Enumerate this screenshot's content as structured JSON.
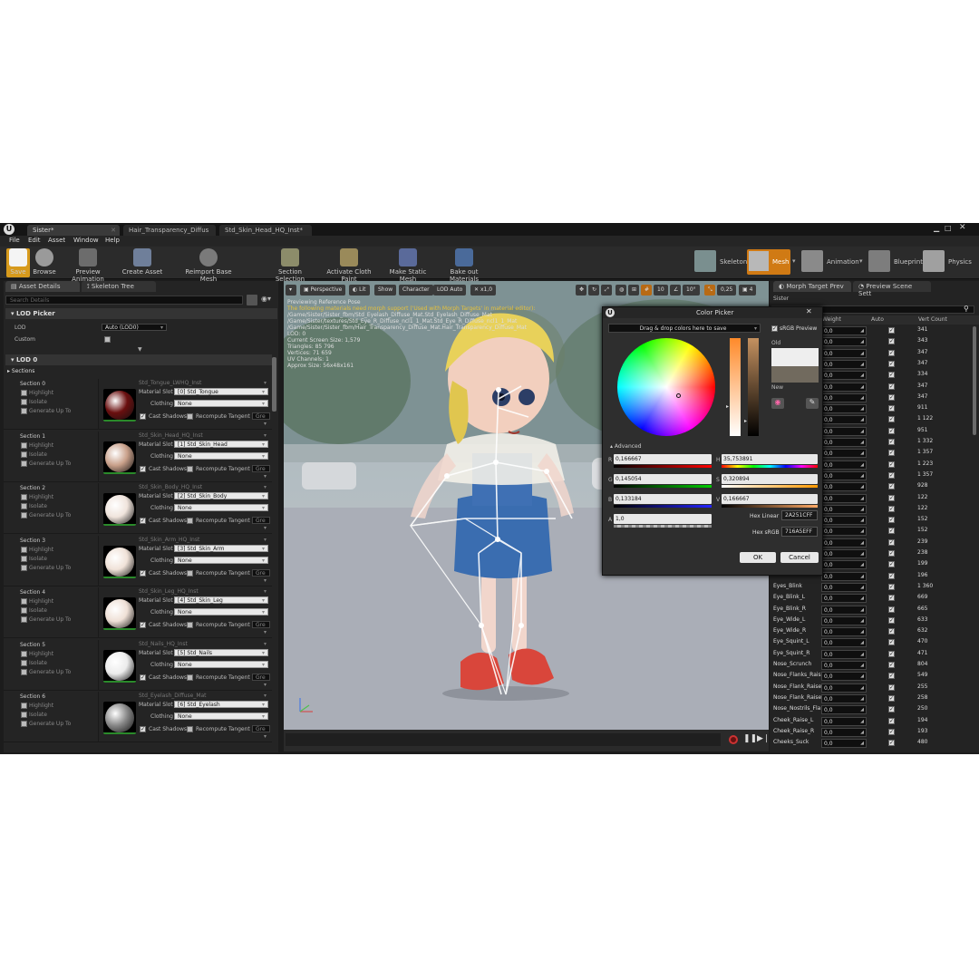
{
  "tabs": [
    {
      "label": "Sister*"
    },
    {
      "label": "Hair_Transparency_Diffus"
    },
    {
      "label": "Std_Skin_Head_HQ_Inst*"
    }
  ],
  "menu": [
    "File",
    "Edit",
    "Asset",
    "Window",
    "Help"
  ],
  "toolbar": {
    "save": "Save",
    "browse": "Browse",
    "preview_animation": "Preview Animation",
    "create_asset": "Create Asset",
    "reimport_base_mesh": "Reimport Base Mesh",
    "section_selection": "Section Selection",
    "activate_cloth_paint": "Activate Cloth Paint",
    "make_static_mesh": "Make Static Mesh",
    "bake_out_materials": "Bake out Materials",
    "modes": {
      "skeleton": "Skeleton",
      "mesh": "Mesh",
      "animation": "Animation",
      "blueprint": "Blueprint",
      "physics": "Physics"
    }
  },
  "left_panel": {
    "tab_asset_details": "Asset Details",
    "tab_skeleton_tree": "Skeleton Tree",
    "search_placeholder": "Search Details",
    "lod_picker": "LOD Picker",
    "lod_label": "LOD",
    "lod_value": "Auto (LOD0)",
    "custom_label": "Custom",
    "lod0": "LOD 0",
    "sections": "Sections",
    "highlight": "Highlight",
    "isolate": "Isolate",
    "generate_up_to": "Generate Up To",
    "material_slot": "Material Slot",
    "clothing": "Clothing",
    "clothing_value": "None",
    "cast_shadows": "Cast Shadows",
    "recompute_tangent": "Recompute Tangent",
    "gre": "Gre",
    "section_items": [
      {
        "title": "Section 0",
        "material": "Std_Tongue_LWHQ_Inst",
        "slot": "[0] Std_Tongue",
        "ball": "#6a0f0f"
      },
      {
        "title": "Section 1",
        "material": "Std_Skin_Head_HQ_Inst",
        "slot": "[1] Std_Skin_Head",
        "ball": "#c9a08a"
      },
      {
        "title": "Section 2",
        "material": "Std_Skin_Body_HQ_Inst",
        "slot": "[2] Std_Skin_Body",
        "ball": "#f0e4dc"
      },
      {
        "title": "Section 3",
        "material": "Std_Skin_Arm_HQ_Inst",
        "slot": "[3] Std_Skin_Arm",
        "ball": "#f0e2d8"
      },
      {
        "title": "Section 4",
        "material": "Std_Skin_Leg_HQ_Inst",
        "slot": "[4] Std_Skin_Leg",
        "ball": "#efe0d6"
      },
      {
        "title": "Section 5",
        "material": "Std_Nails_HQ_Inst",
        "slot": "[5] Std_Nails",
        "ball": "#ececec"
      },
      {
        "title": "Section 6",
        "material": "Std_Eyelash_Diffuse_Mat",
        "slot": "[6] Std_Eyelash",
        "ball": "#888888"
      }
    ]
  },
  "viewport": {
    "perspective": "Perspective",
    "lit": "Lit",
    "show": "Show",
    "character": "Character",
    "lod_auto": "LOD Auto",
    "speed": "x1,0",
    "grid_snap": "10",
    "rot_snap": "10°",
    "scale_snap": "0,25",
    "cam_speed": "4",
    "overlay_lines": [
      "Previewing Reference Pose",
      "The following materials need morph support ('Used with Morph Targets' in material editor):",
      "/Game/Sister/Sister_fbm/Std_Eyelash_Diffuse_Mat.Std_Eyelash_Diffuse_Mat",
      "/Game/Sister/textures/Std_Eye_R_Diffuse_ncl1_1_Mat.Std_Eye_R_Diffuse_ncl1_1_Mat",
      "/Game/Sister/Sister_fbm/Hair_Transparency_Diffuse_Mat.Hair_Transparency_Diffuse_Mat",
      "LOD: 0",
      "Current Screen Size: 1,579",
      "Triangles: 85 796",
      "Vertices: 71 659",
      "UV Channels: 1",
      "Approx Size: 56x48x161"
    ]
  },
  "right_panel": {
    "tab_morph": "Morph Target Prev",
    "tab_scene": "Preview Scene Sett",
    "filter_name": "Sister",
    "col_weight": "Weight",
    "col_auto": "Auto",
    "col_vert": "Vert Count",
    "rows": [
      {
        "name": "",
        "weight": "0,0",
        "verts": "341"
      },
      {
        "name": "",
        "weight": "0,0",
        "verts": "343"
      },
      {
        "name": "",
        "weight": "0,0",
        "verts": "347"
      },
      {
        "name": "",
        "weight": "0,0",
        "verts": "347"
      },
      {
        "name": "",
        "weight": "0,0",
        "verts": "334"
      },
      {
        "name": "",
        "weight": "0,0",
        "verts": "347"
      },
      {
        "name": "",
        "weight": "0,0",
        "verts": "347"
      },
      {
        "name": "",
        "weight": "0,0",
        "verts": "911"
      },
      {
        "name": "",
        "weight": "0,0",
        "verts": "1 122"
      },
      {
        "name": "",
        "weight": "0,0",
        "verts": "951"
      },
      {
        "name": "",
        "weight": "0,0",
        "verts": "1 332"
      },
      {
        "name": "",
        "weight": "0,0",
        "verts": "1 357"
      },
      {
        "name": "",
        "weight": "0,0",
        "verts": "1 223"
      },
      {
        "name": "",
        "weight": "0,0",
        "verts": "1 357"
      },
      {
        "name": "",
        "weight": "0,0",
        "verts": "928"
      },
      {
        "name": "",
        "weight": "0,0",
        "verts": "122"
      },
      {
        "name": "",
        "weight": "0,0",
        "verts": "122"
      },
      {
        "name": "",
        "weight": "0,0",
        "verts": "152"
      },
      {
        "name": "",
        "weight": "0,0",
        "verts": "152"
      },
      {
        "name": "",
        "weight": "0,0",
        "verts": "239"
      },
      {
        "name": "",
        "weight": "0,0",
        "verts": "238"
      },
      {
        "name": "",
        "weight": "0,0",
        "verts": "199"
      },
      {
        "name": "",
        "weight": "0,0",
        "verts": "196"
      },
      {
        "name": "Eyes_Blink",
        "weight": "0,0",
        "verts": "1 360"
      },
      {
        "name": "Eye_Blink_L",
        "weight": "0,0",
        "verts": "669"
      },
      {
        "name": "Eye_Blink_R",
        "weight": "0,0",
        "verts": "665"
      },
      {
        "name": "Eye_Wide_L",
        "weight": "0,0",
        "verts": "633"
      },
      {
        "name": "Eye_Wide_R",
        "weight": "0,0",
        "verts": "632"
      },
      {
        "name": "Eye_Squint_L",
        "weight": "0,0",
        "verts": "470"
      },
      {
        "name": "Eye_Squint_R",
        "weight": "0,0",
        "verts": "471"
      },
      {
        "name": "Nose_Scrunch",
        "weight": "0,0",
        "verts": "804"
      },
      {
        "name": "Nose_Flanks_Raise",
        "weight": "0,0",
        "verts": "549"
      },
      {
        "name": "Nose_Flank_Raise",
        "weight": "0,0",
        "verts": "255"
      },
      {
        "name": "Nose_Flank_Raise",
        "weight": "0,0",
        "verts": "258"
      },
      {
        "name": "Nose_Nostrils_Fla",
        "weight": "0,0",
        "verts": "250"
      },
      {
        "name": "Cheek_Raise_L",
        "weight": "0,0",
        "verts": "194"
      },
      {
        "name": "Cheek_Raise_R",
        "weight": "0,0",
        "verts": "193"
      },
      {
        "name": "Cheeks_Suck",
        "weight": "0,0",
        "verts": "480"
      }
    ]
  },
  "color_picker": {
    "title": "Color Picker",
    "drop_hint": "Drag & drop colors here to save",
    "srgb_preview": "sRGB Preview",
    "old": "Old",
    "new": "New",
    "advanced": "Advanced",
    "r_label": "R",
    "g_label": "G",
    "b_label": "B",
    "a_label": "A",
    "h_label": "H",
    "s_label": "S",
    "v_label": "V",
    "r": "0,166667",
    "g": "0,145054",
    "b": "0,133184",
    "a": "1,0",
    "h": "35,753891",
    "s": "0,320894",
    "v": "0,166667",
    "hex_linear_label": "Hex Linear",
    "hex_linear": "2A251CFF",
    "hex_srgb_label": "Hex sRGB",
    "hex_srgb": "716A5EFF",
    "ok": "OK",
    "cancel": "Cancel",
    "old_color": "#eeeeee",
    "new_color": "#716a5e"
  }
}
